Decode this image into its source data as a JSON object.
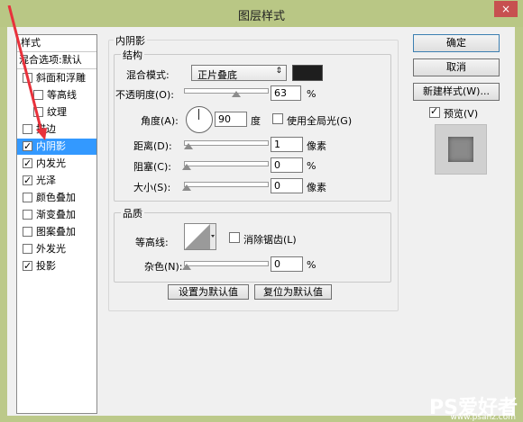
{
  "window": {
    "title": "图层样式",
    "close_glyph": "×"
  },
  "styles_list": {
    "header": "样式",
    "blend_default": "混合选项:默认",
    "items": [
      {
        "label": "斜面和浮雕",
        "checked": false
      },
      {
        "label": "等高线",
        "checked": false
      },
      {
        "label": "纹理",
        "checked": false
      },
      {
        "label": "描边",
        "checked": false
      },
      {
        "label": "内阴影",
        "checked": true,
        "selected": true
      },
      {
        "label": "内发光",
        "checked": true
      },
      {
        "label": "光泽",
        "checked": true
      },
      {
        "label": "颜色叠加",
        "checked": false
      },
      {
        "label": "渐变叠加",
        "checked": false
      },
      {
        "label": "图案叠加",
        "checked": false
      },
      {
        "label": "外发光",
        "checked": false
      },
      {
        "label": "投影",
        "checked": true
      }
    ]
  },
  "inner_shadow": {
    "title": "内阴影",
    "structure": {
      "title": "结构",
      "blend_mode_label": "混合模式:",
      "blend_mode_value": "正片叠底",
      "shadow_color": "#1e1e1e",
      "opacity_label": "不透明度(O):",
      "opacity_value": "63",
      "opacity_unit": "%",
      "opacity_fraction": 0.63,
      "angle_label": "角度(A):",
      "angle_value": "90",
      "angle_unit": "度",
      "global_light_label": "使用全局光(G)",
      "global_light_checked": false,
      "distance_label": "距离(D):",
      "distance_value": "1",
      "distance_unit": "像素",
      "choke_label": "阻塞(C):",
      "choke_value": "0",
      "choke_unit": "%",
      "size_label": "大小(S):",
      "size_value": "0",
      "size_unit": "像素"
    },
    "quality": {
      "title": "品质",
      "contour_label": "等高线:",
      "anti_alias_label": "消除锯齿(L)",
      "anti_alias_checked": false,
      "noise_label": "杂色(N):",
      "noise_value": "0",
      "noise_unit": "%"
    },
    "make_default_button": "设置为默认值",
    "reset_default_button": "复位为默认值"
  },
  "right_buttons": {
    "ok": "确定",
    "cancel": "取消",
    "new_style": "新建样式(W)...",
    "preview_label": "预览(V)",
    "preview_checked": true
  },
  "watermark": {
    "brand": "PS爱好者",
    "url": "www.psahz.com"
  }
}
